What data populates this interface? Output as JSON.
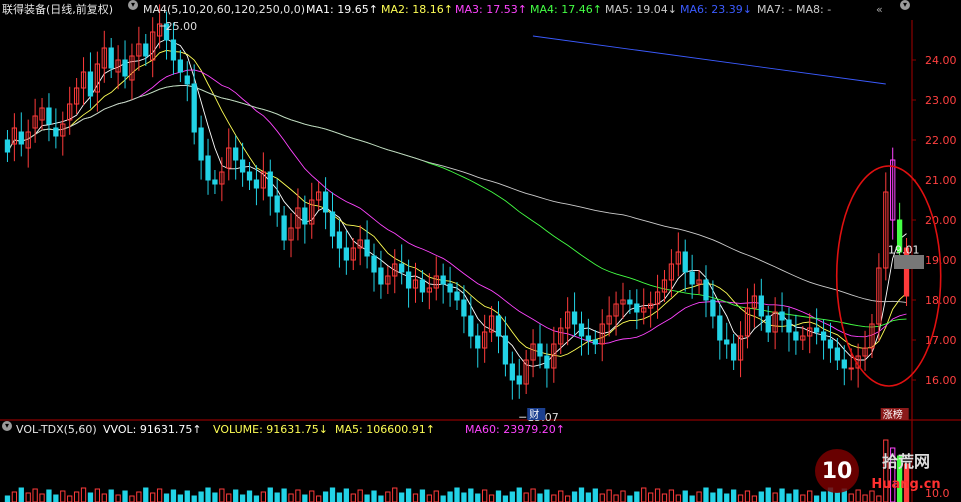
{
  "header": {
    "title": "联得装备(日线,前复权)",
    "ma_setting": "MA4(5,10,20,60,120,250,0,0)",
    "ma1": "MA1: 19.65↑",
    "ma2": "MA2: 18.16↑",
    "ma3": "MA3: 17.53↑",
    "ma4": "MA4: 17.46↑",
    "ma5": "MA5: 19.04↓",
    "ma6": "MA6: 23.39↓",
    "ma7": "MA7: -",
    "ma8": "MA8: -",
    "chevron_icon": "chevron-down-icon",
    "arrows_icon": "double-chevron-icon"
  },
  "volume_header": {
    "title": "VOL-TDX(5,60)",
    "vvol": "VVOL: 91631.75↑",
    "volume": "VOLUME: 91631.75↓",
    "ma5": "MA5: 106600.91↑",
    "ma60": "MA60: 23979.20↑"
  },
  "annotations": {
    "high_price": "25.00",
    "low_price": "15.07",
    "current_price": "19.01",
    "badge_cai": "财",
    "badge_zhangbang": "涨榜"
  },
  "watermark": {
    "line1": "10拾荒网",
    "line2": "Huang.cn"
  },
  "colors": {
    "up": "#ff3b3b",
    "down": "#22d3e6",
    "ma1": "#ffffff",
    "ma2": "#ffff55",
    "ma3": "#ff44ff",
    "ma4": "#44ff44",
    "ma5": "#cccccc",
    "ma6": "#3b5bff",
    "grid": "#8b0000"
  },
  "chart_data": {
    "type": "candlestick",
    "y_ticks": [
      16.0,
      17.0,
      18.0,
      19.0,
      20.0,
      21.0,
      22.0,
      23.0,
      24.0
    ],
    "ylim": [
      15.0,
      25.0
    ],
    "vol_tick": "10.0",
    "candles_close": [
      21.7,
      22.3,
      21.9,
      22.2,
      22.6,
      22.8,
      22.4,
      22.1,
      22.4,
      22.9,
      23.3,
      23.7,
      23.1,
      23.9,
      24.3,
      23.8,
      24.0,
      23.6,
      24.1,
      24.4,
      24.1,
      24.7,
      24.9,
      24.5,
      24.0,
      23.7,
      23.4,
      22.2,
      21.5,
      21.0,
      20.9,
      21.2,
      21.8,
      21.5,
      21.2,
      21.0,
      20.8,
      21.2,
      20.6,
      20.2,
      19.5,
      19.8,
      20.3,
      19.9,
      20.5,
      20.7,
      20.2,
      19.6,
      19.3,
      19.0,
      19.3,
      19.5,
      19.1,
      18.7,
      18.4,
      18.6,
      18.9,
      18.7,
      18.3,
      18.5,
      18.2,
      18.3,
      18.6,
      18.4,
      18.2,
      18.0,
      17.6,
      17.1,
      16.8,
      17.2,
      17.6,
      17.1,
      16.4,
      16.0,
      15.9,
      16.5,
      16.9,
      16.6,
      16.3,
      16.9,
      17.3,
      17.7,
      17.4,
      17.1,
      17.0,
      16.9,
      17.4,
      17.6,
      17.9,
      18.0,
      17.9,
      17.7,
      17.8,
      17.9,
      18.2,
      18.5,
      18.9,
      19.2,
      18.7,
      18.4,
      18.5,
      18.0,
      17.6,
      17.0,
      16.9,
      16.5,
      17.1,
      17.8,
      18.1,
      17.6,
      17.2,
      17.7,
      17.5,
      17.2,
      17.0,
      17.1,
      17.3,
      17.2,
      17.0,
      16.8,
      16.5,
      16.3,
      16.3,
      16.6,
      16.8,
      17.4,
      18.8,
      20.7,
      21.5,
      19.2,
      18.1
    ],
    "candles_open": [
      22.0,
      21.9,
      22.2,
      21.8,
      22.3,
      22.5,
      22.8,
      22.3,
      22.1,
      22.5,
      22.9,
      23.3,
      23.7,
      23.2,
      23.8,
      24.3,
      23.7,
      24.0,
      23.5,
      24.1,
      24.4,
      24.0,
      24.6,
      24.9,
      24.5,
      24.0,
      23.6,
      23.4,
      22.3,
      21.6,
      21.0,
      20.9,
      21.3,
      21.8,
      21.5,
      21.2,
      21.0,
      20.8,
      21.2,
      20.6,
      20.1,
      19.5,
      19.8,
      20.3,
      19.9,
      20.5,
      20.7,
      20.2,
      19.7,
      19.3,
      19.0,
      19.3,
      19.5,
      19.1,
      18.8,
      18.4,
      18.6,
      18.9,
      18.7,
      18.3,
      18.5,
      18.2,
      18.3,
      18.6,
      18.4,
      18.2,
      18.0,
      17.6,
      17.1,
      16.8,
      17.2,
      17.6,
      17.1,
      16.4,
      16.1,
      15.9,
      16.5,
      16.9,
      16.6,
      16.3,
      16.9,
      17.3,
      17.7,
      17.4,
      17.1,
      17.0,
      16.9,
      17.4,
      17.6,
      17.9,
      18.0,
      17.9,
      17.7,
      17.8,
      17.9,
      18.2,
      18.5,
      18.9,
      19.2,
      18.7,
      18.4,
      18.5,
      18.0,
      17.6,
      17.0,
      16.9,
      16.5,
      17.1,
      17.8,
      18.1,
      17.6,
      17.2,
      17.7,
      17.5,
      17.2,
      17.0,
      17.1,
      17.3,
      17.2,
      17.0,
      16.8,
      16.5,
      16.3,
      16.3,
      16.6,
      16.8,
      17.4,
      18.8,
      20.0,
      20.0,
      19.3
    ],
    "series_names": [
      "MA1",
      "MA2",
      "MA3",
      "MA4",
      "MA5",
      "MA6"
    ]
  }
}
